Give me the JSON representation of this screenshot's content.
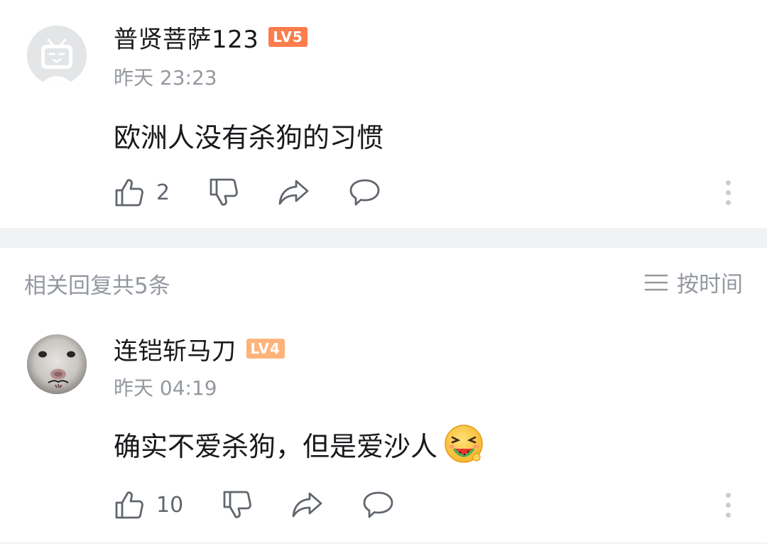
{
  "main_comment": {
    "username": "普贤菩萨123",
    "level": "LV5",
    "level_color": "#fb7d4c",
    "timestamp": "昨天 23:23",
    "content": "欧洲人没有杀狗的习惯",
    "like_count": "2",
    "actions": [
      "like-icon",
      "dislike-icon",
      "share-icon",
      "comment-icon",
      "more-icon"
    ]
  },
  "replies_header": {
    "count_label": "相关回复共5条",
    "sort_label": "按时间",
    "sort_icon": "sort-lines-icon"
  },
  "reply": {
    "username": "连铠斩马刀",
    "level": "LV4",
    "level_color": "#fdb37a",
    "timestamp": "昨天 04:19",
    "content": "确实不爱杀狗，但是爱沙人",
    "emoji": "watermelon-face-emoji",
    "like_count": "10",
    "actions": [
      "like-icon",
      "dislike-icon",
      "share-icon",
      "comment-icon",
      "more-icon"
    ]
  },
  "colors": {
    "text_primary": "#18191c",
    "text_secondary": "#9499a0",
    "icon_gray": "#61666d",
    "divider": "#f1f2f3"
  }
}
